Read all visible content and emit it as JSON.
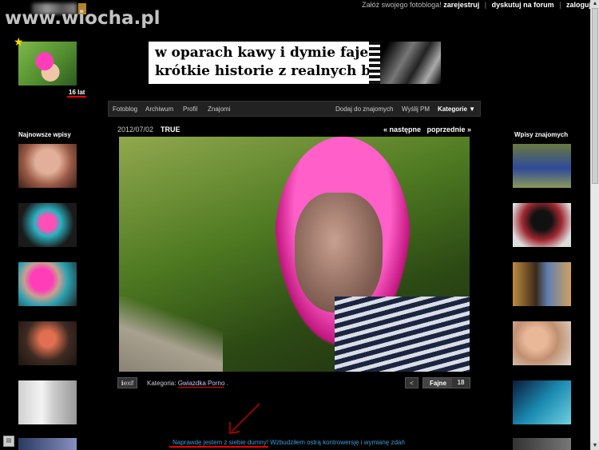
{
  "watermark": {
    "text": "www.wiocha.pl"
  },
  "topbar": {
    "intro": "Załóż swojego fotobloga!",
    "register": "zarejestruj",
    "forum": "dyskutuj na forum",
    "login": "zaloguj",
    "separator": "|"
  },
  "profile": {
    "age": "16 lat"
  },
  "banner": {
    "line1": "w oparach kawy i dymie fajek,",
    "line2": "krótkie historie z realnych bajek"
  },
  "nav": {
    "left": [
      "Fotoblog",
      "Archiwum",
      "Profil",
      "Znajomi"
    ],
    "add_friend": "Dodaj do znajomych",
    "send_pm": "Wyślij PM",
    "categories": "Kategorie"
  },
  "post": {
    "date": "2012/07/02",
    "title": "TRUE",
    "next": "« następne",
    "prev": "poprzednie »",
    "exif": "exif",
    "category_label": "Kategoria:",
    "category_value": "Gwiazdka Porno",
    "category_dot": ".",
    "like_label": "Fajne",
    "like_count": "18"
  },
  "comment": {
    "underlined": "Naprawdę jestem z siebie dumny",
    "rest": "! Wzbudziłem ostrą kontrowersję i wymianę zdań"
  },
  "sidebar_left": {
    "title": "Najnowsze wpisy"
  },
  "sidebar_right": {
    "title": "Wpisy znajomych"
  },
  "colors": {
    "background": "#000000",
    "nav_bg": "#222222",
    "link_blue": "#3b9bd8",
    "accent_red": "#e00000",
    "hair_pink": "#ff3db8"
  },
  "icons": {
    "star": "star-icon",
    "share": "share-icon",
    "info": "info-icon",
    "arrow": "annotation-arrow-icon"
  }
}
